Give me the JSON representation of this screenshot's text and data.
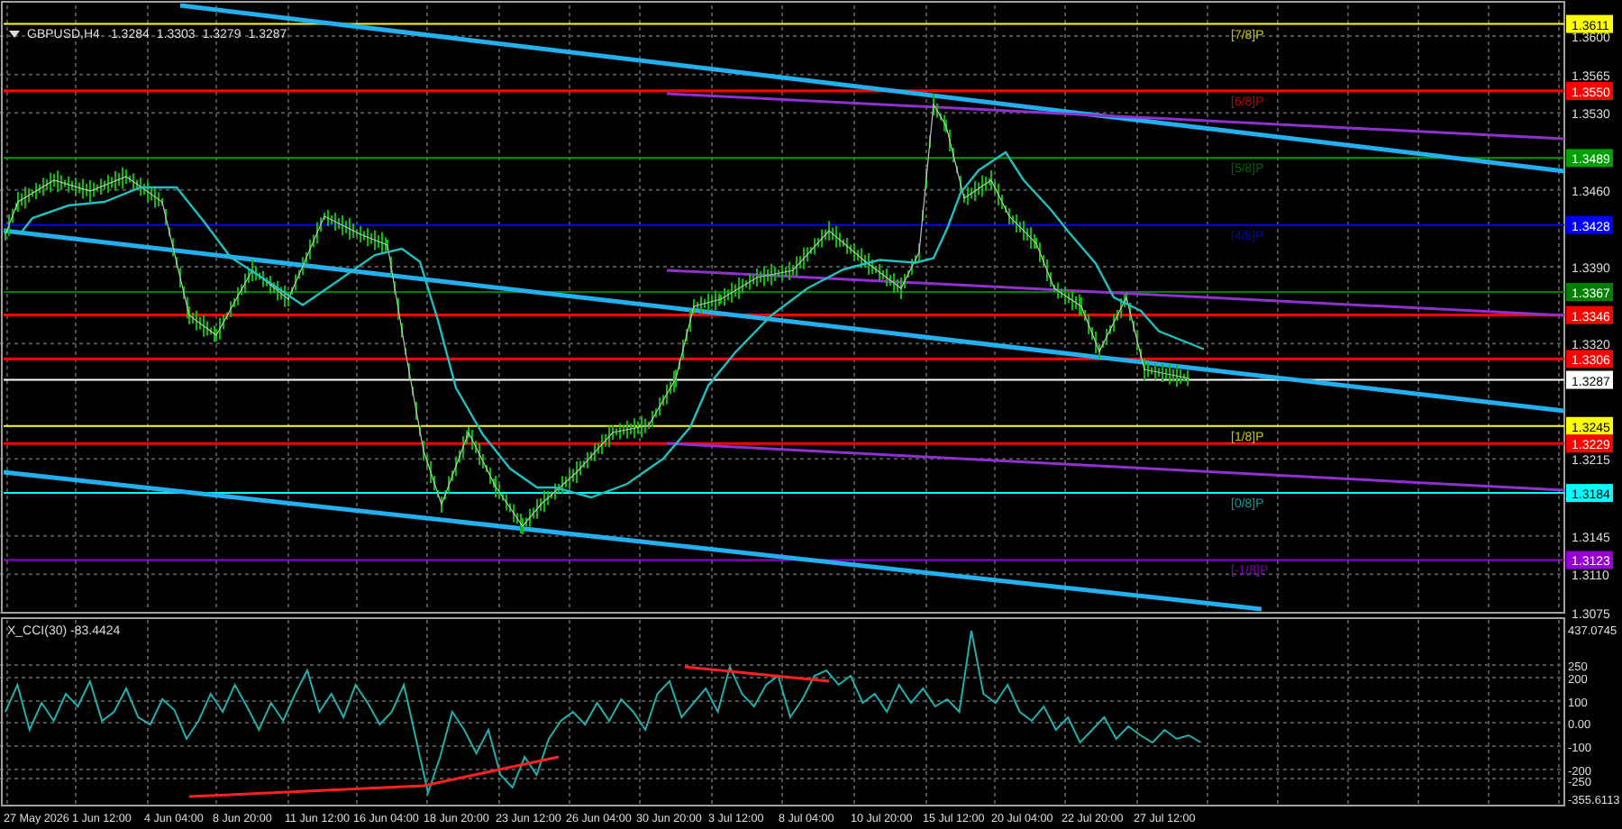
{
  "chart": {
    "symbol": "GBPUSD,H4",
    "quotes": [
      "1.3284",
      "1.3303",
      "1.3279",
      "1.3287"
    ]
  },
  "price_axis": [
    "1.3600",
    "1.3565",
    "1.3530",
    "1.3460",
    "1.3390",
    "1.3320",
    "1.3215",
    "1.3145",
    "1.3110",
    "1.3075"
  ],
  "levels": [
    {
      "price": "1.3611",
      "color": "#ffff00"
    },
    {
      "price": "1.3550",
      "color": "#ff0000"
    },
    {
      "price": "1.3489",
      "color": "#00a000"
    },
    {
      "price": "1.3428",
      "color": "#0000ff"
    },
    {
      "price": "1.3367",
      "color": "#008000"
    },
    {
      "price": "1.3346",
      "color": "#ff0000"
    },
    {
      "price": "1.3306",
      "color": "#ff0000"
    },
    {
      "price": "1.3287",
      "color": "#ffffff"
    },
    {
      "price": "1.3245",
      "color": "#ffff00"
    },
    {
      "price": "1.3229",
      "color": "#ff0000"
    },
    {
      "price": "1.3184",
      "color": "#00ffff"
    },
    {
      "price": "1.3123",
      "color": "#9400d3"
    }
  ],
  "murrey_labels": [
    {
      "text": "[7/8]P",
      "color": "#c8c800"
    },
    {
      "text": "[6/8]P",
      "color": "#c00000"
    },
    {
      "text": "[5/8]P",
      "color": "#006400"
    },
    {
      "text": "[4/8]P",
      "color": "#0000c8"
    },
    {
      "text": "[1/8]P",
      "color": "#c8c800"
    },
    {
      "text": "[0/8]P",
      "color": "#00a0a0"
    },
    {
      "text": "[-1/8]P",
      "color": "#7a00b0"
    }
  ],
  "indicator": {
    "title": "X_CCI(30) -83.4424",
    "axis": [
      "437.0745",
      "250",
      "200",
      "100",
      "0.00",
      "-100",
      "-200",
      "-250",
      "-355.6113"
    ]
  },
  "time_axis": [
    "27 May 2026",
    "1 Jun 12:00",
    "4 Jun 04:00",
    "8 Jun 20:00",
    "11 Jun 12:00",
    "16 Jun 04:00",
    "18 Jun 20:00",
    "23 Jun 12:00",
    "26 Jun 04:00",
    "30 Jun 20:00",
    "3 Jul 12:00",
    "8 Jul 04:00",
    "10 Jul 20:00",
    "15 Jul 12:00",
    "20 Jul 04:00",
    "22 Jul 20:00",
    "27 Jul 12:00"
  ]
}
